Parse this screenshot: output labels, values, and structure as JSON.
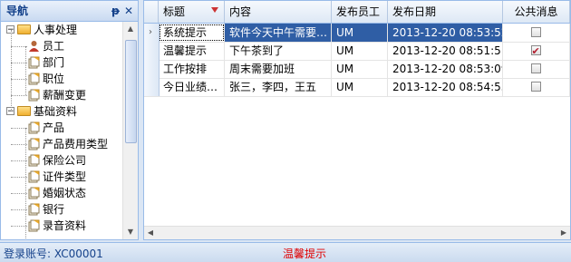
{
  "nav": {
    "title": "导航",
    "pin_icon": "pin-icon",
    "close_icon": "close-icon",
    "tree": [
      {
        "label": "人事处理",
        "level": 0,
        "type": "folder",
        "expanded": true
      },
      {
        "label": "员工",
        "level": 1,
        "type": "user"
      },
      {
        "label": "部门",
        "level": 1,
        "type": "doc"
      },
      {
        "label": "职位",
        "level": 1,
        "type": "doc"
      },
      {
        "label": "薪酬变更",
        "level": 1,
        "type": "doc"
      },
      {
        "label": "基础资料",
        "level": 0,
        "type": "folder",
        "expanded": true
      },
      {
        "label": "产品",
        "level": 1,
        "type": "doc"
      },
      {
        "label": "产品费用类型",
        "level": 1,
        "type": "doc"
      },
      {
        "label": "保险公司",
        "level": 1,
        "type": "doc"
      },
      {
        "label": "证件类型",
        "level": 1,
        "type": "doc"
      },
      {
        "label": "婚姻状态",
        "level": 1,
        "type": "doc"
      },
      {
        "label": "银行",
        "level": 1,
        "type": "doc"
      },
      {
        "label": "录音资料",
        "level": 1,
        "type": "doc"
      }
    ]
  },
  "grid": {
    "columns": [
      "标题",
      "内容",
      "发布员工",
      "发布日期",
      "公共消息"
    ],
    "rows": [
      {
        "title": "系统提示",
        "content": "软件今天中午需要…",
        "employee": "UM",
        "date": "2013-12-20 08:53:52",
        "public": false,
        "selected": true
      },
      {
        "title": "温馨提示",
        "content": "下午茶到了",
        "employee": "UM",
        "date": "2013-12-20 08:51:51",
        "public": true,
        "selected": false
      },
      {
        "title": "工作按排",
        "content": "周末需要加班",
        "employee": "UM",
        "date": "2013-12-20 08:53:09",
        "public": false,
        "selected": false
      },
      {
        "title": "今日业绩…",
        "content": "张三，李四，王五",
        "employee": "UM",
        "date": "2013-12-20 08:54:55",
        "public": false,
        "selected": false
      }
    ]
  },
  "status": {
    "account": "登录账号: XC00001",
    "message": "温馨提示"
  },
  "colors": {
    "selection": "#2f5ea5",
    "status_message": "#e00000",
    "border": "#99bbe8"
  }
}
